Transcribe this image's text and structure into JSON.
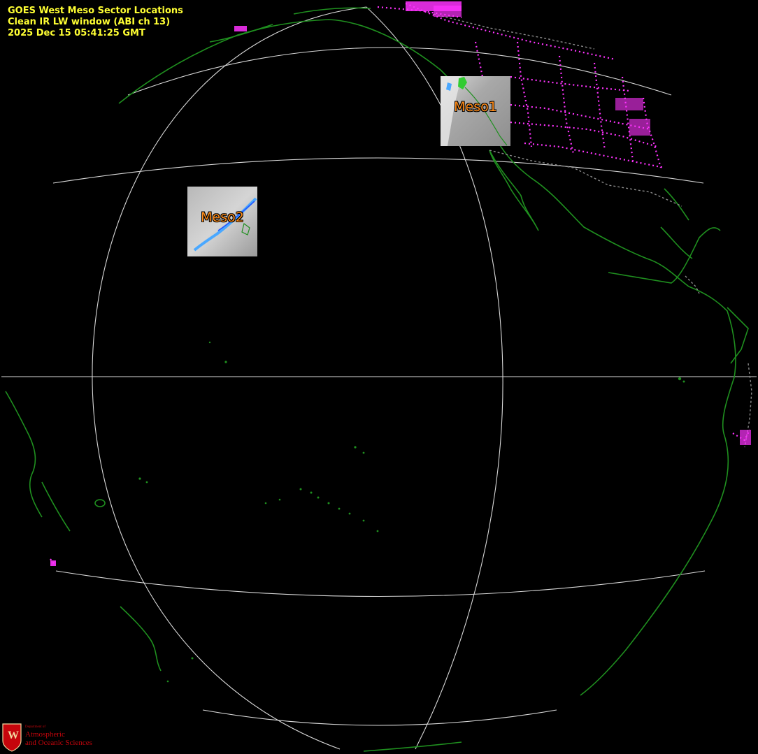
{
  "header": {
    "line1": "GOES West Meso Sector Locations",
    "line2": "Clean IR LW window (ABI ch 13)",
    "line3": "2025 Dec 15  05:41:25 GMT"
  },
  "sectors": {
    "meso1": {
      "label": "Meso1"
    },
    "meso2": {
      "label": "Meso2"
    }
  },
  "logo": {
    "seal_letter": "W",
    "line1": "Department of",
    "line2": "Atmospheric",
    "line3": "and Oceanic Sciences"
  },
  "colors": {
    "background": "#000000",
    "header_text": "#ffff33",
    "sector_label": "#ff8c1a",
    "coastline": "#1f8f1f",
    "state_borders": "#ff33ff",
    "national_borders": "#8a8a8a",
    "graticule": "#d8d8d8",
    "logo_red": "#c5050c"
  }
}
